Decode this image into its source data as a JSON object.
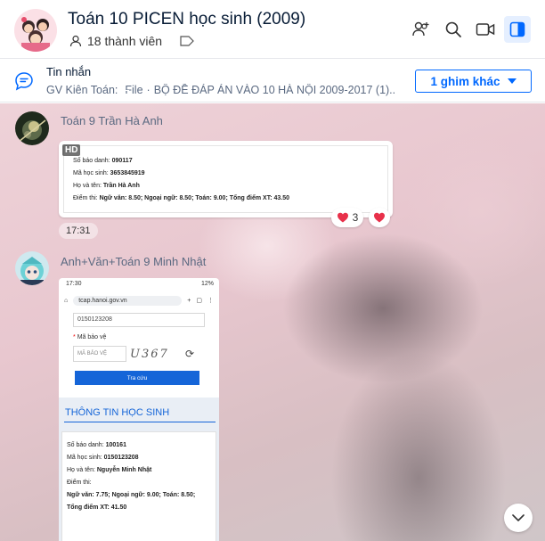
{
  "header": {
    "title": "Toán 10 PICEN học sinh (2009)",
    "members": "18 thành viên"
  },
  "pinned": {
    "label": "Tin nhắn",
    "sender": "GV Kiên Toán:",
    "file_prefix": "File",
    "file_name": "BỘ ĐỀ ĐÁP ÁN VÀO 10 HÀ NỘI 2009-2017 (1)...",
    "more_button": "1 ghim khác"
  },
  "messages": [
    {
      "sender": "Toán 9 Trần Hà Anh",
      "hd_badge": "HD",
      "lines": [
        {
          "label": "Số báo danh:",
          "value": "090117"
        },
        {
          "label": "Mã học sinh:",
          "value": "3653845919"
        },
        {
          "label": "Họ và tên:",
          "value": "Trần Hà Anh"
        },
        {
          "label": "Điểm thi:",
          "value": "Ngữ văn: 8.50; Ngoại ngữ: 8.50; Toán: 9.00; Tổng điểm XT: 43.50"
        }
      ],
      "reaction_count": "3",
      "time": "17:31"
    },
    {
      "sender": "Anh+Văn+Toán 9 Minh Nhật",
      "phone": {
        "status_time": "17:30",
        "status_right": "12%",
        "url": "tcap.hanoi.gov.vn",
        "student_code_field": "0150123208",
        "captcha_label": "Mã bảo vệ",
        "captcha_placeholder": "MÃ BẢO VỆ",
        "captcha_text": "U367",
        "submit": "Tra cứu",
        "section_title": "THÔNG TIN HỌC SINH",
        "lines": [
          {
            "label": "Số báo danh:",
            "value": "100161"
          },
          {
            "label": "Mã học sinh:",
            "value": "0150123208"
          },
          {
            "label": "Họ và tên:",
            "value": "Nguyễn Minh Nhật"
          }
        ],
        "score_label": "Điểm thi:",
        "score_line1": "Ngữ văn: 7.75; Ngoại ngữ: 9.00; Toán: 8.50;",
        "score_line2": "Tổng điểm XT: 41.50"
      }
    }
  ],
  "colors": {
    "accent": "#0068ff",
    "heart": "#e8304a"
  },
  "icons": {
    "add_member": "add-member-icon",
    "search": "search-icon",
    "video": "video-call-icon",
    "panel": "sidebar-toggle-icon",
    "scroll": "chevron-down-icon"
  }
}
